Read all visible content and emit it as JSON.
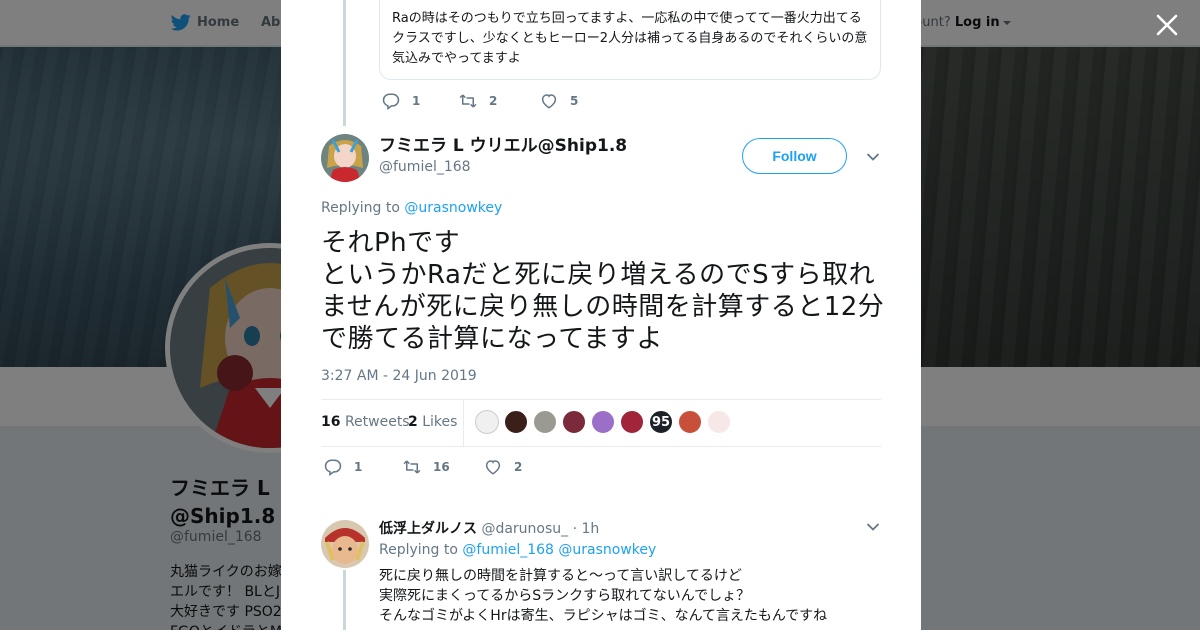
{
  "topbar": {
    "home_label": "Home",
    "about_label": "Abo",
    "account_prompt": "ccount?",
    "login_label": "Log in"
  },
  "profile": {
    "name_line1": "フミエラ L",
    "name_line2": "@Ship1.8",
    "handle": "@fumiel_168",
    "bio": "丸猫ライクのお嫁\nエルです！ BLとJ\n大好きです PSO2\nFGOとイドラとM"
  },
  "prev_tweet": {
    "quote_text": "Raの時はそのつもりで立ち回ってますよ、一応私の中で使ってて一番火力出てるクラスですし、少なくともヒーロー2人分は補ってる自身あるのでそれくらいの意気込みでやってますよ",
    "reply_count": "1",
    "retweet_count": "2",
    "like_count": "5"
  },
  "main_tweet": {
    "name": "フミエラ L ウリエル@Ship1.8",
    "handle": "@fumiel_168",
    "follow_label": "Follow",
    "replying_prefix": "Replying to",
    "replying_to": "@urasnowkey",
    "text": "それPhです\nというかRaだと死に戻り増えるのでSすら取れませんが死に戻り無しの時間を計算すると12分で勝てる計算になってますよ",
    "timestamp": "3:27 AM - 24 Jun 2019",
    "retweets_count": "16",
    "retweets_label": "Retweets",
    "likes_count": "2",
    "likes_label": "Likes",
    "face_95": "95",
    "reply_count": "1",
    "retweet_count": "16",
    "like_count": "2"
  },
  "reply": {
    "name": "低浮上ダルノス",
    "handle": "@darunosu_",
    "time": "· 1h",
    "replying_prefix": "Replying to",
    "replying_to_1": "@fumiel_168",
    "replying_to_2": "@urasnowkey",
    "text": "死に戻り無しの時間を計算すると～って言い訳してるけど\n実際死にまくってるからSランクすら取れてないんでしょ？\nそんなゴミがよくHrは寄生、ラピシャはゴミ、なんて言えたもんですね"
  },
  "colors": {
    "accent": "#1da1f2",
    "secondary_text": "#657786",
    "overlay": "rgba(0,0,0,0.5)"
  },
  "icons": [
    "twitter-bird-icon",
    "close-icon",
    "reply-icon",
    "retweet-icon",
    "like-icon",
    "chevron-down-icon"
  ]
}
